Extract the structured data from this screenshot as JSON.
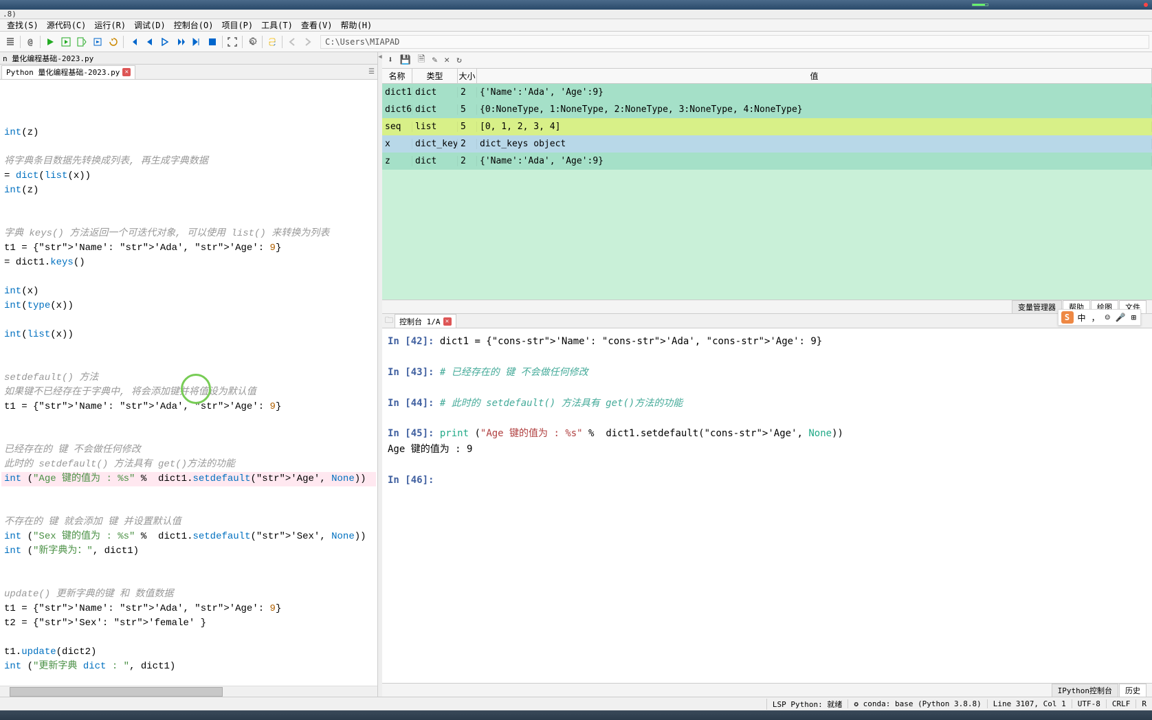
{
  "version_label": ".8)",
  "menu": [
    "查找(S)",
    "源代码(C)",
    "运行(R)",
    "调试(D)",
    "控制台(O)",
    "项目(P)",
    "工具(T)",
    "查看(V)",
    "帮助(H)"
  ],
  "address_path": "C:\\Users\\MIAPAD",
  "file_tab": "n 量化编程基础-2023.py",
  "editor_tab": "Python 量化编程基础-2023.py",
  "code_lines": [
    {
      "t": "int(z)",
      "cls": ""
    },
    {
      "t": "",
      "cls": ""
    },
    {
      "t": "将字典条目数据先转换成列表, 再生成字典数据",
      "cls": "comment"
    },
    {
      "t": "= dict(list(x))",
      "cls": ""
    },
    {
      "t": "int(z)",
      "cls": ""
    },
    {
      "t": "",
      "cls": ""
    },
    {
      "t": "",
      "cls": ""
    },
    {
      "t": "字典 keys() 方法返回一个可迭代对象, 可以使用 list() 来转换为列表",
      "cls": "comment"
    },
    {
      "t": "t1 = {'Name': 'Ada', 'Age': 9}",
      "cls": ""
    },
    {
      "t": "= dict1.keys()",
      "cls": ""
    },
    {
      "t": "",
      "cls": ""
    },
    {
      "t": "int(x)",
      "cls": ""
    },
    {
      "t": "int(type(x))",
      "cls": ""
    },
    {
      "t": "",
      "cls": ""
    },
    {
      "t": "int(list(x))",
      "cls": ""
    },
    {
      "t": "",
      "cls": ""
    },
    {
      "t": "",
      "cls": ""
    },
    {
      "t": "setdefault() 方法",
      "cls": "comment"
    },
    {
      "t": "如果键不已经存在于字典中, 将会添加键并将值设为默认值",
      "cls": "comment"
    },
    {
      "t": "t1 = {'Name': 'Ada', 'Age': 9}",
      "cls": ""
    },
    {
      "t": "",
      "cls": ""
    },
    {
      "t": "",
      "cls": ""
    },
    {
      "t": "已经存在的 键 不会做任何修改",
      "cls": "comment"
    },
    {
      "t": "此时的 setdefault() 方法具有 get()方法的功能",
      "cls": "comment"
    },
    {
      "t": "int (\"Age 键的值为 : %s\" %  dict1.setdefault('Age', None))",
      "cls": "hl"
    },
    {
      "t": "",
      "cls": ""
    },
    {
      "t": "",
      "cls": ""
    },
    {
      "t": "不存在的 键 就会添加 键 并设置默认值",
      "cls": "comment"
    },
    {
      "t": "int (\"Sex 键的值为 : %s\" %  dict1.setdefault('Sex', None))",
      "cls": ""
    },
    {
      "t": "int (\"新字典为：\", dict1)",
      "cls": ""
    },
    {
      "t": "",
      "cls": ""
    },
    {
      "t": "",
      "cls": ""
    },
    {
      "t": "update() 更新字典的键 和 数值数据",
      "cls": "comment"
    },
    {
      "t": "t1 = {'Name': 'Ada', 'Age': 9}",
      "cls": ""
    },
    {
      "t": "t2 = {'Sex': 'female' }",
      "cls": ""
    },
    {
      "t": "",
      "cls": ""
    },
    {
      "t": "t1.update(dict2)",
      "cls": ""
    },
    {
      "t": "int (\"更新字典 dict : \", dict1)",
      "cls": ""
    }
  ],
  "var_headers": {
    "name": "名称",
    "type": "类型",
    "size": "大小",
    "value": "值"
  },
  "vars": [
    {
      "name": "dict1",
      "type": "dict",
      "size": "2",
      "value": "{'Name':'Ada', 'Age':9}",
      "cls": "dict-row"
    },
    {
      "name": "dict6",
      "type": "dict",
      "size": "5",
      "value": "{0:NoneType, 1:NoneType, 2:NoneType, 3:NoneType, 4:NoneType}",
      "cls": "dict-row"
    },
    {
      "name": "seq",
      "type": "list",
      "size": "5",
      "value": "[0, 1, 2, 3, 4]",
      "cls": "list-row"
    },
    {
      "name": "x",
      "type": "dict_keys",
      "size": "2",
      "value": "dict_keys object",
      "cls": "obj-row"
    },
    {
      "name": "z",
      "type": "dict",
      "size": "2",
      "value": "{'Name':'Ada', 'Age':9}",
      "cls": "dict-row"
    }
  ],
  "pane_tabs": [
    "变量管理器",
    "帮助",
    "绘图",
    "文件"
  ],
  "console_tab": "控制台 1/A",
  "console_lines": [
    {
      "num": "42",
      "code": "dict1 = {'Name': 'Ada', 'Age': 9}"
    },
    {
      "num": "43",
      "comment": "# 已经存在的 键 不会做任何修改"
    },
    {
      "num": "44",
      "comment": "# 此时的 setdefault() 方法具有 get()方法的功能"
    },
    {
      "num": "45",
      "code": "print (\"Age 键的值为 : %s\" %  dict1.setdefault('Age', None))"
    }
  ],
  "console_output": "Age 键的值为 : 9",
  "console_prompt_next": "46",
  "ime": {
    "lang": "中",
    "punct": "，",
    "face": "☺",
    "mic": "🎤",
    "grid": "⊞"
  },
  "status_tabs": [
    "IPython控制台",
    "历史"
  ],
  "status": {
    "lsp": "LSP Python: 就绪",
    "conda": "conda: base (Python 3.8.8)",
    "pos": "Line 3107, Col 1",
    "enc": "UTF-8",
    "eol": "CRLF",
    "mode": "R"
  }
}
